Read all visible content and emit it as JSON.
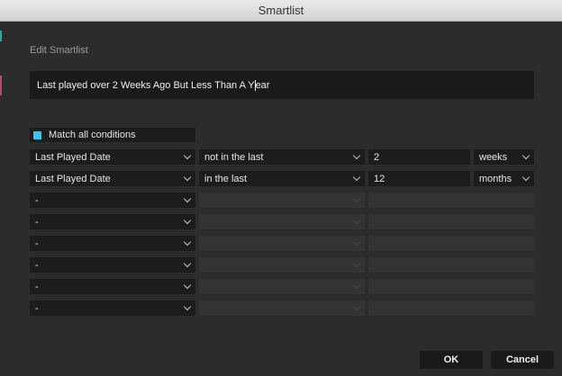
{
  "window": {
    "title": "Smartlist"
  },
  "editor": {
    "section_label": "Edit Smartlist",
    "name_before_cursor": "Last played over 2 Weeks Ago But Less Than A Y",
    "name_after_cursor": "ear",
    "match_all_label": "Match all conditions",
    "match_all_checked": true
  },
  "conditions": [
    {
      "field": "Last Played Date",
      "operator": "not in the last",
      "value": "2",
      "unit": "weeks"
    },
    {
      "field": "Last Played Date",
      "operator": "in the last",
      "value": "12",
      "unit": "months"
    },
    {
      "field": "-"
    },
    {
      "field": "-"
    },
    {
      "field": "-"
    },
    {
      "field": "-"
    },
    {
      "field": "-"
    },
    {
      "field": "-"
    }
  ],
  "buttons": {
    "ok": "OK",
    "cancel": "Cancel"
  },
  "colors": {
    "accent": "#3cc6ea",
    "background": "#2c2c2c",
    "field": "#1c1c1c"
  }
}
